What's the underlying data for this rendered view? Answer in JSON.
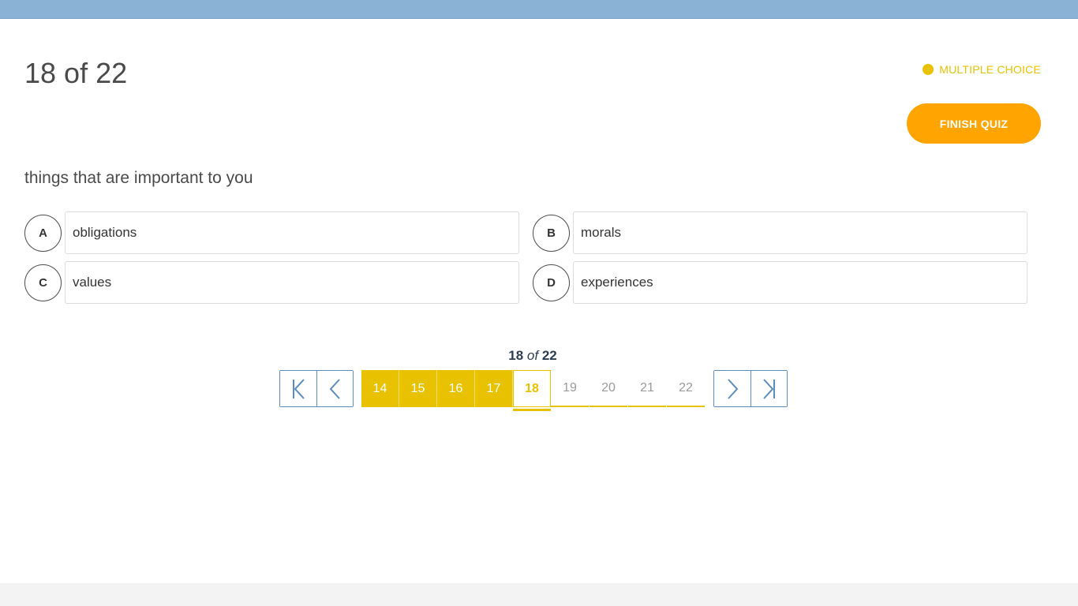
{
  "header": {
    "counter": "18 of 22",
    "question_type": "MULTIPLE CHOICE",
    "finish_label": "FINISH QUIZ"
  },
  "question": {
    "text": "things that are important to you",
    "options": [
      {
        "letter": "A",
        "text": "obligations"
      },
      {
        "letter": "B",
        "text": "morals"
      },
      {
        "letter": "C",
        "text": "values"
      },
      {
        "letter": "D",
        "text": "experiences"
      }
    ]
  },
  "pagination": {
    "current": "18",
    "of_word": "of",
    "total": "22",
    "pages": [
      "14",
      "15",
      "16",
      "17",
      "18",
      "19",
      "20",
      "21",
      "22"
    ],
    "icons": {
      "first": "first-page-icon",
      "prev": "chevron-left-icon",
      "next": "chevron-right-icon",
      "last": "last-page-icon"
    }
  },
  "colors": {
    "topbar": "#8ab2d5",
    "accent": "#e8c100",
    "finish": "#ffa400",
    "nav": "#5b8cbf"
  }
}
